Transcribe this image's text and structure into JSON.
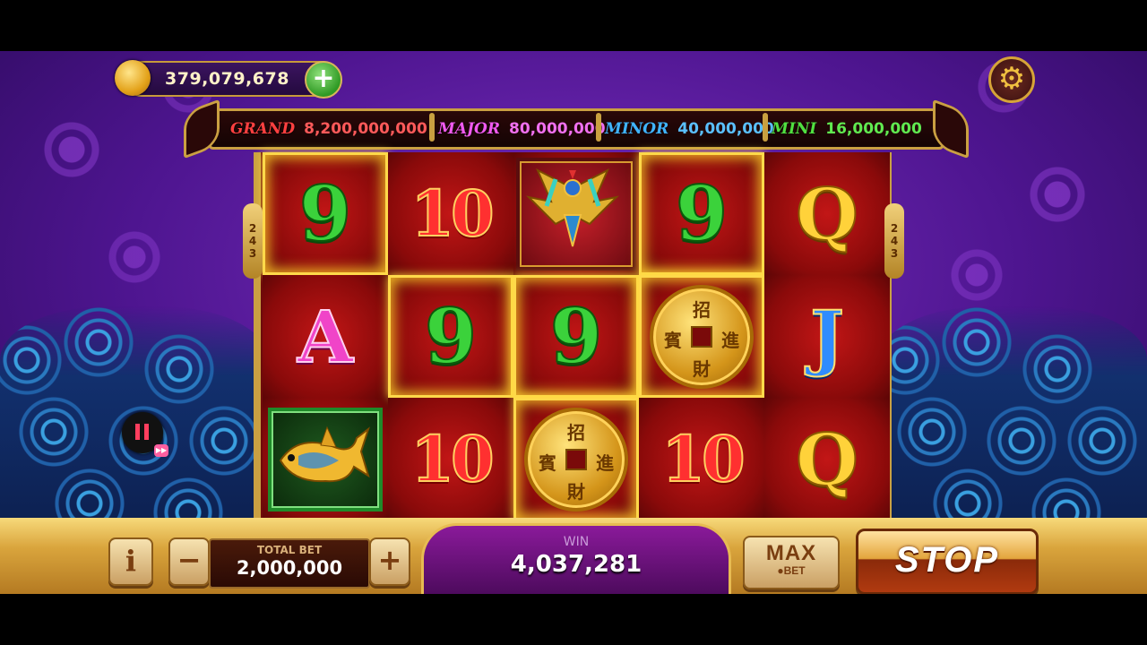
{
  "balance": {
    "value": "379,079,678"
  },
  "jackpots": [
    {
      "name": "GRAND",
      "value": "8,200,000,000",
      "name_color": "#ff4040",
      "value_color": "#ff5a5a"
    },
    {
      "name": "MAJOR",
      "value": "80,000,000",
      "name_color": "#f05af0",
      "value_color": "#f070f0"
    },
    {
      "name": "MINOR",
      "value": "40,000,000",
      "name_color": "#40b4ff",
      "value_color": "#5ac0ff"
    },
    {
      "name": "MINI",
      "value": "16,000,000",
      "name_color": "#50e040",
      "value_color": "#60ea50"
    }
  ],
  "ways_badge": {
    "d1": "2",
    "d2": "4",
    "d3": "3"
  },
  "reels": [
    [
      {
        "symbol": "9",
        "style": "green",
        "win": true
      },
      {
        "symbol": "A",
        "style": "pink",
        "win": false
      },
      {
        "symbol": "fish-icon",
        "style": "fish",
        "win": false
      }
    ],
    [
      {
        "symbol": "10",
        "style": "red",
        "win": false
      },
      {
        "symbol": "9",
        "style": "green",
        "win": true
      },
      {
        "symbol": "10",
        "style": "red",
        "win": false
      }
    ],
    [
      {
        "symbol": "phoenix-icon",
        "style": "bird",
        "win": false
      },
      {
        "symbol": "9",
        "style": "green",
        "win": true
      },
      {
        "symbol": "coin-icon",
        "style": "coin",
        "win": true
      }
    ],
    [
      {
        "symbol": "9",
        "style": "green",
        "win": true
      },
      {
        "symbol": "coin-icon",
        "style": "coin",
        "win": true
      },
      {
        "symbol": "10",
        "style": "red",
        "win": false
      }
    ],
    [
      {
        "symbol": "Q",
        "style": "gold",
        "win": false
      },
      {
        "symbol": "J",
        "style": "blue",
        "win": false
      },
      {
        "symbol": "Q",
        "style": "gold",
        "win": false
      }
    ]
  ],
  "coin_chars": {
    "top": "招",
    "left": "賓",
    "right": "進",
    "bottom": "財"
  },
  "controls": {
    "info_label": "i",
    "minus_label": "−",
    "plus_label": "+",
    "total_bet_label": "TOTAL BET",
    "total_bet_value": "2,000,000",
    "win_label": "WIN",
    "win_value": "4,037,281",
    "max_label": "MAX",
    "max_sub_label": "●BET",
    "stop_label": "STOP"
  }
}
